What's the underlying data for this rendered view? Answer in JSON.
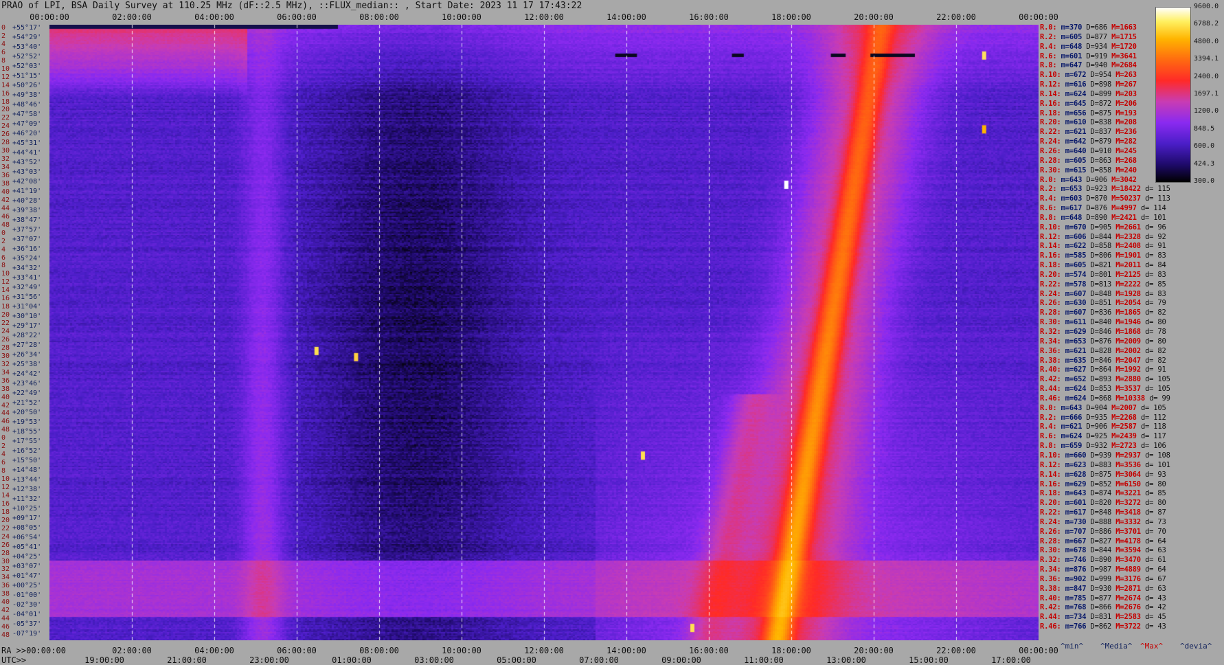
{
  "title": "PRAO of LPI, BSA Daily Survey at 110.25 MHz (dF::2.5 MHz), ::FLUX_median:: , Start Date: 2023 11 17 17:43:22",
  "chart_data": {
    "type": "heatmap",
    "x_top_ticks": [
      "00:00:00",
      "02:00:00",
      "04:00:00",
      "06:00:00",
      "08:00:00",
      "10:00:00",
      "12:00:00",
      "14:00:00",
      "16:00:00",
      "18:00:00",
      "20:00:00",
      "22:00:00",
      "00:00:00"
    ],
    "x_bottom_ra_ticks": [
      "RA >>00:00:00",
      "02:00:00",
      "04:00:00",
      "06:00:00",
      "08:00:00",
      "10:00:00",
      "12:00:00",
      "14:00:00",
      "16:00:00",
      "18:00:00",
      "20:00:00",
      "22:00:00",
      "00:00:00"
    ],
    "x_bottom_utc_ticks": [
      "UTC>>",
      "19:00:00",
      "21:00:00",
      "23:00:00",
      "01:00:00",
      "03:00:00",
      "05:00:00",
      "07:00:00",
      "09:00:00",
      "11:00:00",
      "13:00:00",
      "15:00:00",
      "17:00:00"
    ],
    "declinations": [
      "+55°17'",
      "+54°29'",
      "+53°40'",
      "+52°52'",
      "+52°03'",
      "+51°15'",
      "+50°26'",
      "+49°38'",
      "+48°46'",
      "+47°58'",
      "+47°09'",
      "+46°20'",
      "+45°31'",
      "+44°41'",
      "+43°52'",
      "+43°03'",
      "+42°08'",
      "+41°19'",
      "+40°28'",
      "+39°38'",
      "+38°47'",
      "+37°57'",
      "+37°07'",
      "+36°16'",
      "+35°24'",
      "+34°32'",
      "+33°41'",
      "+32°49'",
      "+31°56'",
      "+31°04'",
      "+30°10'",
      "+29°17'",
      "+28°22'",
      "+27°28'",
      "+26°34'",
      "+25°38'",
      "+24°42'",
      "+23°46'",
      "+22°49'",
      "+21°52'",
      "+20°50'",
      "+19°53'",
      "+18°55'",
      "+17°55'",
      "+16°52'",
      "+15°50'",
      "+14°48'",
      "+13°44'",
      "+12°38'",
      "+11°32'",
      "+10°25'",
      "+09°17'",
      "+08°05'",
      "+06°54'",
      "+05°41'",
      "+04°25'",
      "+03°07'",
      "+01°47'",
      "+00°25'",
      "-01°00'",
      "-02°30'",
      "-04°01'",
      "-05°37'",
      "-07°19'"
    ],
    "beam_numbers": [
      "0",
      "2",
      "4",
      "6",
      "8",
      "10",
      "12",
      "14",
      "16",
      "18",
      "20",
      "22",
      "24",
      "26",
      "28",
      "30",
      "32",
      "34",
      "36",
      "38",
      "40",
      "42",
      "44",
      "46",
      "48",
      "0",
      "2",
      "4",
      "6",
      "8",
      "10",
      "12",
      "14",
      "16",
      "18",
      "20",
      "22",
      "24",
      "26",
      "28",
      "30",
      "32",
      "34",
      "36",
      "38",
      "40",
      "42",
      "44",
      "46",
      "48",
      "0",
      "2",
      "4",
      "6",
      "8",
      "10",
      "12",
      "14",
      "16",
      "18",
      "20",
      "22",
      "24",
      "26",
      "28",
      "30",
      "32",
      "34",
      "36",
      "38",
      "40",
      "42",
      "44",
      "46",
      "48"
    ],
    "colorbar_ticks": [
      "9600.0",
      "6788.2",
      "4800.0",
      "3394.1",
      "2400.0",
      "1697.1",
      "1200.0",
      "848.5",
      "600.0",
      "424.3",
      "300.0"
    ],
    "colorbar_range": [
      300,
      9600
    ],
    "colorbar_scale": "log",
    "colors": [
      "#000000",
      "#1e0a6a",
      "#4b1ec8",
      "#8a2af0",
      "#c83cb4",
      "#ff2a28",
      "#ff6a10",
      "#ffb400",
      "#fff060",
      "#ffffff"
    ],
    "stats": [
      {
        "r": "R.0:",
        "m": "m=370",
        "d": "D=686",
        "mx": "M=1663",
        "dev": ""
      },
      {
        "r": "R.2:",
        "m": "m=605",
        "d": "D=877",
        "mx": "M=1715",
        "dev": ""
      },
      {
        "r": "R.4:",
        "m": "m=648",
        "d": "D=934",
        "mx": "M=1720",
        "dev": ""
      },
      {
        "r": "R.6:",
        "m": "m=601",
        "d": "D=919",
        "mx": "M=3641",
        "dev": ""
      },
      {
        "r": "R.8:",
        "m": "m=647",
        "d": "D=940",
        "mx": "M=2684",
        "dev": ""
      },
      {
        "r": "R.10:",
        "m": "m=672",
        "d": "D=954",
        "mx": "M=263",
        "dev": ""
      },
      {
        "r": "R.12:",
        "m": "m=616",
        "d": "D=898",
        "mx": "M=267",
        "dev": ""
      },
      {
        "r": "R.14:",
        "m": "m=624",
        "d": "D=899",
        "mx": "M=203",
        "dev": ""
      },
      {
        "r": "R.16:",
        "m": "m=645",
        "d": "D=872",
        "mx": "M=206",
        "dev": ""
      },
      {
        "r": "R.18:",
        "m": "m=656",
        "d": "D=875",
        "mx": "M=193",
        "dev": ""
      },
      {
        "r": "R.20:",
        "m": "m=610",
        "d": "D=838",
        "mx": "M=208",
        "dev": ""
      },
      {
        "r": "R.22:",
        "m": "m=621",
        "d": "D=837",
        "mx": "M=236",
        "dev": ""
      },
      {
        "r": "R.24:",
        "m": "m=642",
        "d": "D=879",
        "mx": "M=282",
        "dev": ""
      },
      {
        "r": "R.26:",
        "m": "m=640",
        "d": "D=910",
        "mx": "M=245",
        "dev": ""
      },
      {
        "r": "R.28:",
        "m": "m=605",
        "d": "D=863",
        "mx": "M=268",
        "dev": ""
      },
      {
        "r": "R.30:",
        "m": "m=615",
        "d": "D=858",
        "mx": "M=240",
        "dev": ""
      },
      {
        "r": "R.0:",
        "m": "m=643",
        "d": "D=906",
        "mx": "M=3042",
        "dev": ""
      },
      {
        "r": "R.2:",
        "m": "m=653",
        "d": "D=923",
        "mx": "M=18422",
        "dev": "d= 115"
      },
      {
        "r": "R.4:",
        "m": "m=603",
        "d": "D=870",
        "mx": "M=50237",
        "dev": "d= 113"
      },
      {
        "r": "R.6:",
        "m": "m=617",
        "d": "D=876",
        "mx": "M=4997",
        "dev": "d= 114"
      },
      {
        "r": "R.8:",
        "m": "m=648",
        "d": "D=890",
        "mx": "M=2421",
        "dev": "d= 101"
      },
      {
        "r": "R.10:",
        "m": "m=670",
        "d": "D=905",
        "mx": "M=2661",
        "dev": "d= 96"
      },
      {
        "r": "R.12:",
        "m": "m=606",
        "d": "D=844",
        "mx": "M=2328",
        "dev": "d= 92"
      },
      {
        "r": "R.14:",
        "m": "m=622",
        "d": "D=858",
        "mx": "M=2408",
        "dev": "d= 91"
      },
      {
        "r": "R.16:",
        "m": "m=585",
        "d": "D=806",
        "mx": "M=1901",
        "dev": "d= 83"
      },
      {
        "r": "R.18:",
        "m": "m=605",
        "d": "D=821",
        "mx": "M=2011",
        "dev": "d= 84"
      },
      {
        "r": "R.20:",
        "m": "m=574",
        "d": "D=801",
        "mx": "M=2125",
        "dev": "d= 83"
      },
      {
        "r": "R.22:",
        "m": "m=578",
        "d": "D=813",
        "mx": "M=2222",
        "dev": "d= 85"
      },
      {
        "r": "R.24:",
        "m": "m=607",
        "d": "D=848",
        "mx": "M=1928",
        "dev": "d= 83"
      },
      {
        "r": "R.26:",
        "m": "m=630",
        "d": "D=851",
        "mx": "M=2054",
        "dev": "d= 79"
      },
      {
        "r": "R.28:",
        "m": "m=607",
        "d": "D=836",
        "mx": "M=1865",
        "dev": "d= 82"
      },
      {
        "r": "R.30:",
        "m": "m=611",
        "d": "D=840",
        "mx": "M=1946",
        "dev": "d= 80"
      },
      {
        "r": "R.32:",
        "m": "m=629",
        "d": "D=846",
        "mx": "M=1868",
        "dev": "d= 78"
      },
      {
        "r": "R.34:",
        "m": "m=653",
        "d": "D=876",
        "mx": "M=2009",
        "dev": "d= 80"
      },
      {
        "r": "R.36:",
        "m": "m=621",
        "d": "D=828",
        "mx": "M=2002",
        "dev": "d= 82"
      },
      {
        "r": "R.38:",
        "m": "m=635",
        "d": "D=846",
        "mx": "M=2047",
        "dev": "d= 82"
      },
      {
        "r": "R.40:",
        "m": "m=627",
        "d": "D=864",
        "mx": "M=1992",
        "dev": "d= 91"
      },
      {
        "r": "R.42:",
        "m": "m=652",
        "d": "D=893",
        "mx": "M=2880",
        "dev": "d= 105"
      },
      {
        "r": "R.44:",
        "m": "m=624",
        "d": "D=853",
        "mx": "M=3537",
        "dev": "d= 105"
      },
      {
        "r": "R.46:",
        "m": "m=624",
        "d": "D=868",
        "mx": "M=10338",
        "dev": "d= 99"
      },
      {
        "r": "R.0:",
        "m": "m=643",
        "d": "D=904",
        "mx": "M=2007",
        "dev": "d= 105"
      },
      {
        "r": "R.2:",
        "m": "m=666",
        "d": "D=935",
        "mx": "M=2268",
        "dev": "d= 112"
      },
      {
        "r": "R.4:",
        "m": "m=621",
        "d": "D=906",
        "mx": "M=2587",
        "dev": "d= 118"
      },
      {
        "r": "R.6:",
        "m": "m=624",
        "d": "D=925",
        "mx": "M=2439",
        "dev": "d= 117"
      },
      {
        "r": "R.8:",
        "m": "m=659",
        "d": "D=932",
        "mx": "M=2723",
        "dev": "d= 106"
      },
      {
        "r": "R.10:",
        "m": "m=660",
        "d": "D=939",
        "mx": "M=2937",
        "dev": "d= 108"
      },
      {
        "r": "R.12:",
        "m": "m=623",
        "d": "D=883",
        "mx": "M=3536",
        "dev": "d= 101"
      },
      {
        "r": "R.14:",
        "m": "m=628",
        "d": "D=875",
        "mx": "M=3064",
        "dev": "d= 93"
      },
      {
        "r": "R.16:",
        "m": "m=629",
        "d": "D=852",
        "mx": "M=6150",
        "dev": "d= 80"
      },
      {
        "r": "R.18:",
        "m": "m=643",
        "d": "D=874",
        "mx": "M=3221",
        "dev": "d= 85"
      },
      {
        "r": "R.20:",
        "m": "m=601",
        "d": "D=820",
        "mx": "M=3272",
        "dev": "d= 80"
      },
      {
        "r": "R.22:",
        "m": "m=617",
        "d": "D=848",
        "mx": "M=3418",
        "dev": "d= 87"
      },
      {
        "r": "R.24:",
        "m": "m=730",
        "d": "D=888",
        "mx": "M=3332",
        "dev": "d= 73"
      },
      {
        "r": "R.26:",
        "m": "m=707",
        "d": "D=886",
        "mx": "M=3701",
        "dev": "d= 70"
      },
      {
        "r": "R.28:",
        "m": "m=667",
        "d": "D=827",
        "mx": "M=4178",
        "dev": "d= 64"
      },
      {
        "r": "R.30:",
        "m": "m=678",
        "d": "D=844",
        "mx": "M=3594",
        "dev": "d= 63"
      },
      {
        "r": "R.32:",
        "m": "m=746",
        "d": "D=890",
        "mx": "M=3470",
        "dev": "d= 61"
      },
      {
        "r": "R.34:",
        "m": "m=876",
        "d": "D=987",
        "mx": "M=4889",
        "dev": "d= 64"
      },
      {
        "r": "R.36:",
        "m": "m=902",
        "d": "D=999",
        "mx": "M=3176",
        "dev": "d= 67"
      },
      {
        "r": "R.38:",
        "m": "m=847",
        "d": "D=930",
        "mx": "M=2871",
        "dev": "d= 63"
      },
      {
        "r": "R.40:",
        "m": "m=785",
        "d": "D=877",
        "mx": "M=2674",
        "dev": "d= 43"
      },
      {
        "r": "R.42:",
        "m": "m=768",
        "d": "D=866",
        "mx": "M=2676",
        "dev": "d= 42"
      },
      {
        "r": "R.44:",
        "m": "m=734",
        "d": "D=831",
        "mx": "M=2583",
        "dev": "d= 45"
      },
      {
        "r": "R.46:",
        "m": "m=766",
        "d": "D=862",
        "mx": "M=3722",
        "dev": "d= 43"
      }
    ],
    "legend": [
      "^min^",
      "^Media^",
      "^Max^",
      "^devia^"
    ]
  }
}
